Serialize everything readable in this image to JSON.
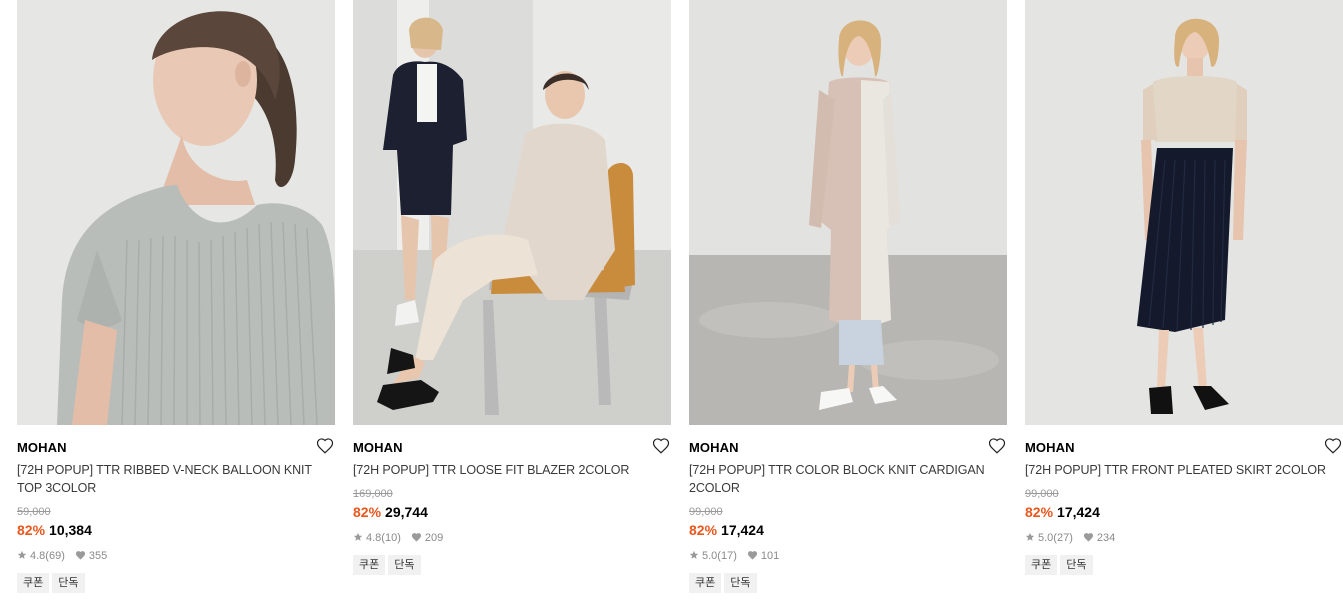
{
  "products": [
    {
      "brand": "MOHAN",
      "title": "[72H POPUP] TTR RIBBED V-NECK BALLOON KNIT TOP 3COLOR",
      "original_price": "59,000",
      "discount": "82%",
      "price": "10,384",
      "rating": "4.8",
      "reviews": "(69)",
      "likes": "355",
      "tags": [
        "쿠폰",
        "단독"
      ]
    },
    {
      "brand": "MOHAN",
      "title": "[72H POPUP] TTR LOOSE FIT BLAZER 2COLOR",
      "original_price": "169,000",
      "discount": "82%",
      "price": "29,744",
      "rating": "4.8",
      "reviews": "(10)",
      "likes": "209",
      "tags": [
        "쿠폰",
        "단독"
      ]
    },
    {
      "brand": "MOHAN",
      "title": "[72H POPUP] TTR COLOR BLOCK KNIT CARDIGAN 2COLOR",
      "original_price": "99,000",
      "discount": "82%",
      "price": "17,424",
      "rating": "5.0",
      "reviews": "(17)",
      "likes": "101",
      "tags": [
        "쿠폰",
        "단독"
      ]
    },
    {
      "brand": "MOHAN",
      "title": "[72H POPUP] TTR FRONT PLEATED SKIRT 2COLOR",
      "original_price": "99,000",
      "discount": "82%",
      "price": "17,424",
      "rating": "5.0",
      "reviews": "(27)",
      "likes": "234",
      "tags": [
        "쿠폰",
        "단독"
      ]
    }
  ],
  "icons": {
    "wishlist": "heart-outline-icon",
    "rating": "star-icon",
    "likes": "heart-filled-icon"
  },
  "colors": {
    "discount": "#e8571d",
    "tag_bg": "#f1f1f1",
    "meta_text": "#8a8a8a"
  }
}
